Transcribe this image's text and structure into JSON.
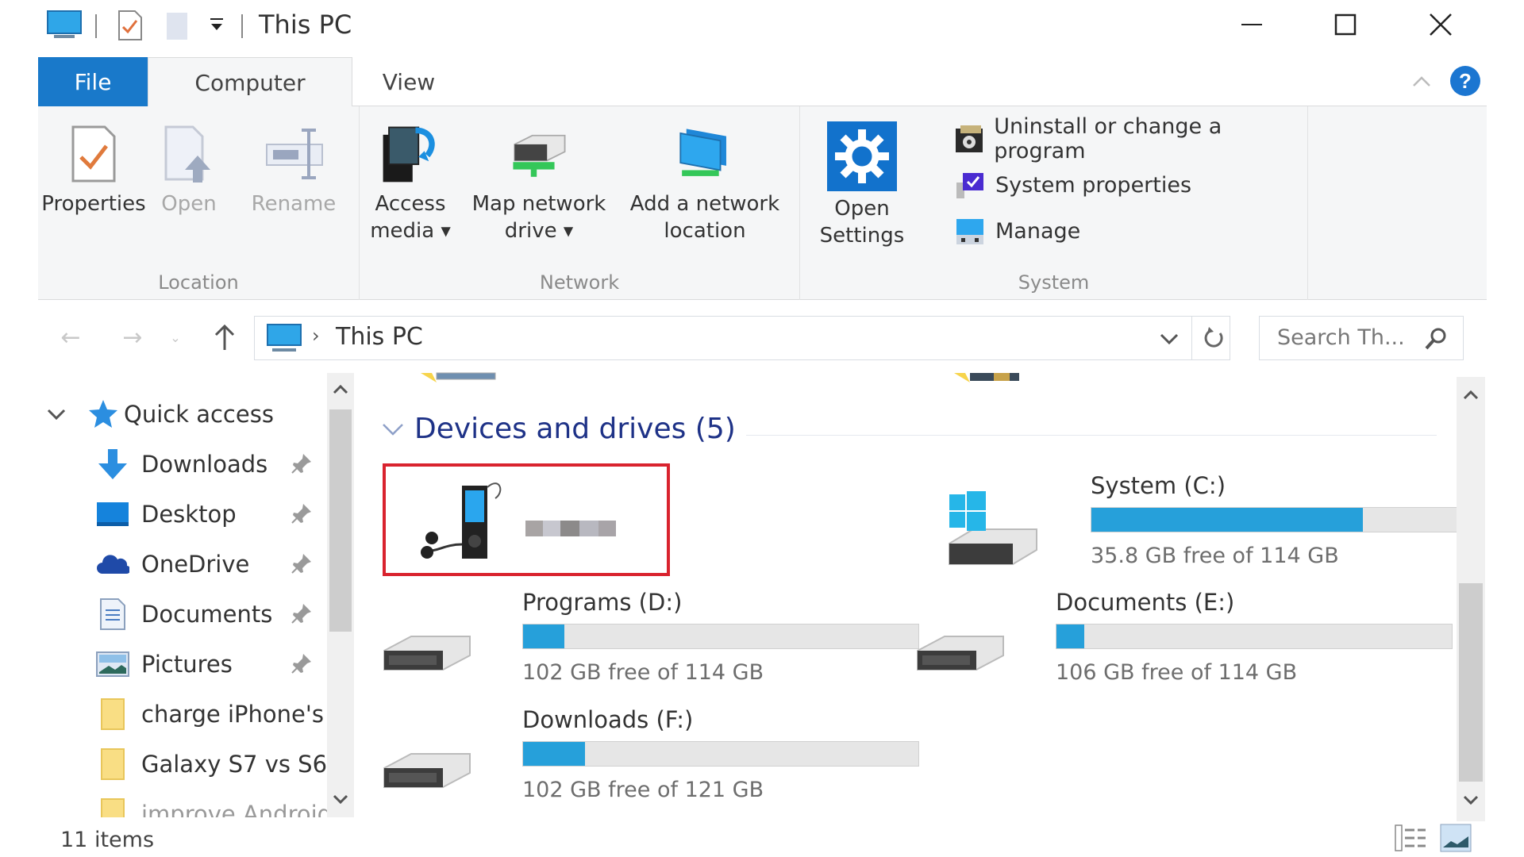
{
  "window": {
    "title": "This PC",
    "controls": {
      "minimize": "minimize",
      "maximize": "maximize",
      "close": "close"
    }
  },
  "ribbon_tabs": [
    {
      "label": "File"
    },
    {
      "label": "Computer"
    },
    {
      "label": "View"
    }
  ],
  "ribbon": {
    "groups": [
      {
        "label": "Location",
        "buttons": [
          {
            "label": "Properties",
            "enabled": true
          },
          {
            "label": "Open",
            "enabled": false
          },
          {
            "label": "Rename",
            "enabled": false
          }
        ]
      },
      {
        "label": "Network",
        "buttons": [
          {
            "line1": "Access",
            "line2": "media",
            "dropdown": true
          },
          {
            "line1": "Map network",
            "line2": "drive",
            "dropdown": true
          },
          {
            "line1": "Add a network",
            "line2": "location",
            "dropdown": false
          }
        ]
      },
      {
        "label": "System",
        "buttons": [
          {
            "line1": "Open",
            "line2": "Settings"
          }
        ],
        "small_buttons": [
          {
            "label": "Uninstall or change a program"
          },
          {
            "label": "System properties"
          },
          {
            "label": "Manage"
          }
        ]
      }
    ]
  },
  "address_bar": {
    "path": [
      "This PC"
    ],
    "separator": "›"
  },
  "search": {
    "placeholder": "Search Th..."
  },
  "nav_pane": {
    "root": {
      "label": "Quick access",
      "expanded": true
    },
    "items": [
      {
        "label": "Downloads",
        "pinned": true,
        "icon": "downloads"
      },
      {
        "label": "Desktop",
        "pinned": true,
        "icon": "desktop"
      },
      {
        "label": "OneDrive",
        "pinned": true,
        "icon": "onedrive"
      },
      {
        "label": "Documents",
        "pinned": true,
        "icon": "documents"
      },
      {
        "label": "Pictures",
        "pinned": true,
        "icon": "pictures"
      },
      {
        "label": "charge iPhone's",
        "pinned": false,
        "icon": "folder"
      },
      {
        "label": "Galaxy S7 vs S6",
        "pinned": false,
        "icon": "folder"
      },
      {
        "label": "improve Android...",
        "pinned": false,
        "icon": "folder"
      }
    ]
  },
  "content": {
    "section_title": "Devices and drives (5)",
    "device": {
      "name": "[redacted]",
      "highlight_color": "#d9232e"
    },
    "drives": [
      {
        "name": "System (C:)",
        "free": "35.8 GB free of 114 GB",
        "used_fraction": 0.686,
        "icon": "windows-drive"
      },
      {
        "name": "Programs (D:)",
        "free": "102 GB free of 114 GB",
        "used_fraction": 0.105,
        "icon": "drive"
      },
      {
        "name": "Documents (E:)",
        "free": "106 GB free of 114 GB",
        "used_fraction": 0.07,
        "icon": "drive"
      },
      {
        "name": "Downloads (F:)",
        "free": "102 GB free of 121 GB",
        "used_fraction": 0.157,
        "icon": "drive"
      }
    ]
  },
  "status_bar": {
    "item_count": "11 items"
  },
  "colors": {
    "accent": "#1979ca",
    "bar_fill": "#26a0da",
    "section_title": "#1e3287"
  }
}
